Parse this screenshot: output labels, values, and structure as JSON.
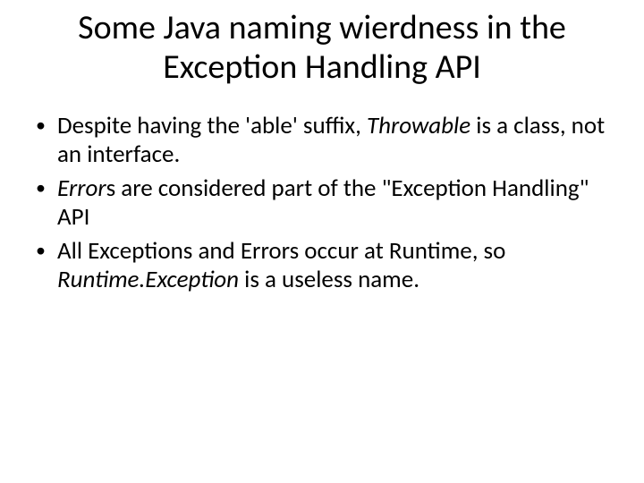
{
  "title": "Some Java naming wierdness in the Exception Handling API",
  "bullets": {
    "b1a": "Despite having the 'able' suffix, ",
    "b1b": "Throwable",
    "b1c": " is a class, not an interface.",
    "b2a": "Error",
    "b2b": "s are considered part of the \"Exception Handling\" API",
    "b3a": "All Exceptions and Errors occur at Runtime, so ",
    "b3b": "Runtime.Exception",
    "b3c": " is a useless name."
  }
}
